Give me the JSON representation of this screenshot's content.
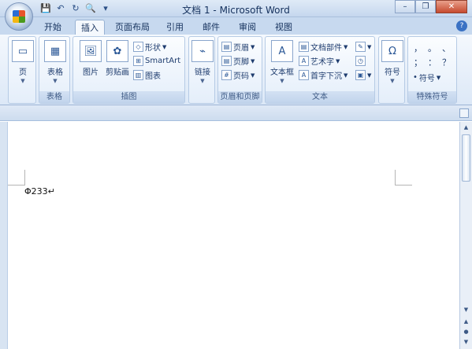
{
  "window": {
    "title": "文档 1 - Microsoft Word"
  },
  "quick_access": {
    "icons": [
      "save-icon",
      "undo-icon",
      "redo-icon",
      "print-preview-icon",
      "customize-icon"
    ]
  },
  "tabs": [
    {
      "label": "开始"
    },
    {
      "label": "插入",
      "active": true
    },
    {
      "label": "页面布局"
    },
    {
      "label": "引用"
    },
    {
      "label": "邮件"
    },
    {
      "label": "审阅"
    },
    {
      "label": "视图"
    }
  ],
  "ribbon": {
    "pages": {
      "page_label": "页",
      "group_label": ""
    },
    "tables": {
      "table_label": "表格",
      "group_label": "表格"
    },
    "illustrations": {
      "picture_label": "图片",
      "clipart_label": "剪贴画",
      "shapes_label": "形状",
      "smartart_label": "SmartArt",
      "chart_label": "图表",
      "group_label": "插图"
    },
    "links": {
      "link_label": "链接",
      "group_label": ""
    },
    "header_footer": {
      "header_label": "页眉",
      "footer_label": "页脚",
      "page_number_label": "页码",
      "group_label": "页眉和页脚"
    },
    "text": {
      "textbox_label": "文本框",
      "quickparts_label": "文档部件",
      "wordart_label": "艺术字",
      "dropcap_label": "首字下沉",
      "group_label": "文本"
    },
    "symbols": {
      "symbol_label": "符号",
      "group_label": ""
    },
    "special": {
      "symbols_row1": [
        "，",
        "。",
        "、"
      ],
      "symbols_row2": [
        "；",
        "：",
        "？"
      ],
      "symbol_dd_label": "符号",
      "group_label": "特殊符号"
    }
  },
  "document": {
    "content": "Φ233↵"
  }
}
